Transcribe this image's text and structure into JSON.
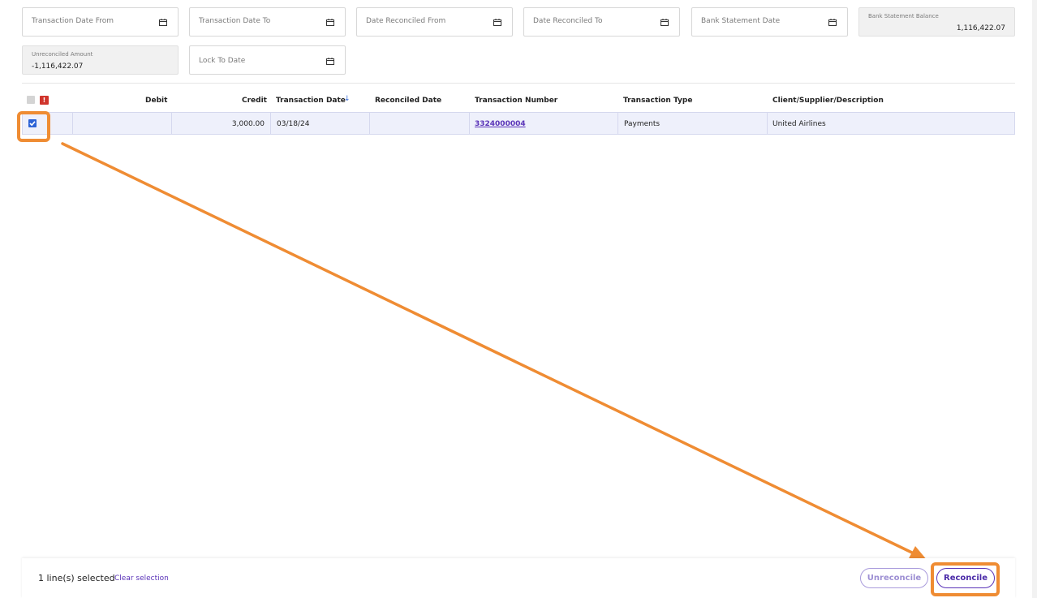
{
  "filters": {
    "transaction_date_from": "Transaction Date From",
    "transaction_date_to": "Transaction Date To",
    "date_reconciled_from": "Date Reconciled From",
    "date_reconciled_to": "Date Reconciled To",
    "bank_statement_date": "Bank Statement Date",
    "lock_to_date": "Lock To Date",
    "calendar_icon": "calendar-icon"
  },
  "summary": {
    "bank_statement_balance_label": "Bank Statement Balance",
    "bank_statement_balance_value": "1,116,422.07",
    "unreconciled_amount_label": "Unreconciled Amount",
    "unreconciled_amount_value": "-1,116,422.07"
  },
  "table": {
    "warning_badge": "!",
    "columns": {
      "debit": "Debit",
      "credit": "Credit",
      "transaction_date": "Transaction Date",
      "sort_indicator": "↓",
      "reconciled_date": "Reconciled Date",
      "transaction_number": "Transaction Number",
      "transaction_type": "Transaction Type",
      "client": "Client/Supplier/Description"
    },
    "rows": [
      {
        "checked": true,
        "debit": "",
        "credit": "3,000.00",
        "transaction_date": "03/18/24",
        "reconciled_date": "",
        "transaction_number": "3324000004",
        "transaction_type": "Payments",
        "client": "United Airlines"
      }
    ]
  },
  "footer": {
    "selected_text": "1 line(s) selected",
    "clear_selection": "Clear selection",
    "unreconcile_label": "Unreconcile",
    "reconcile_label": "Reconcile"
  },
  "colors": {
    "annotation": "#ef8c33",
    "accent": "#5a33b8",
    "checkbox": "#2d63d6",
    "warning": "#d0342c"
  }
}
